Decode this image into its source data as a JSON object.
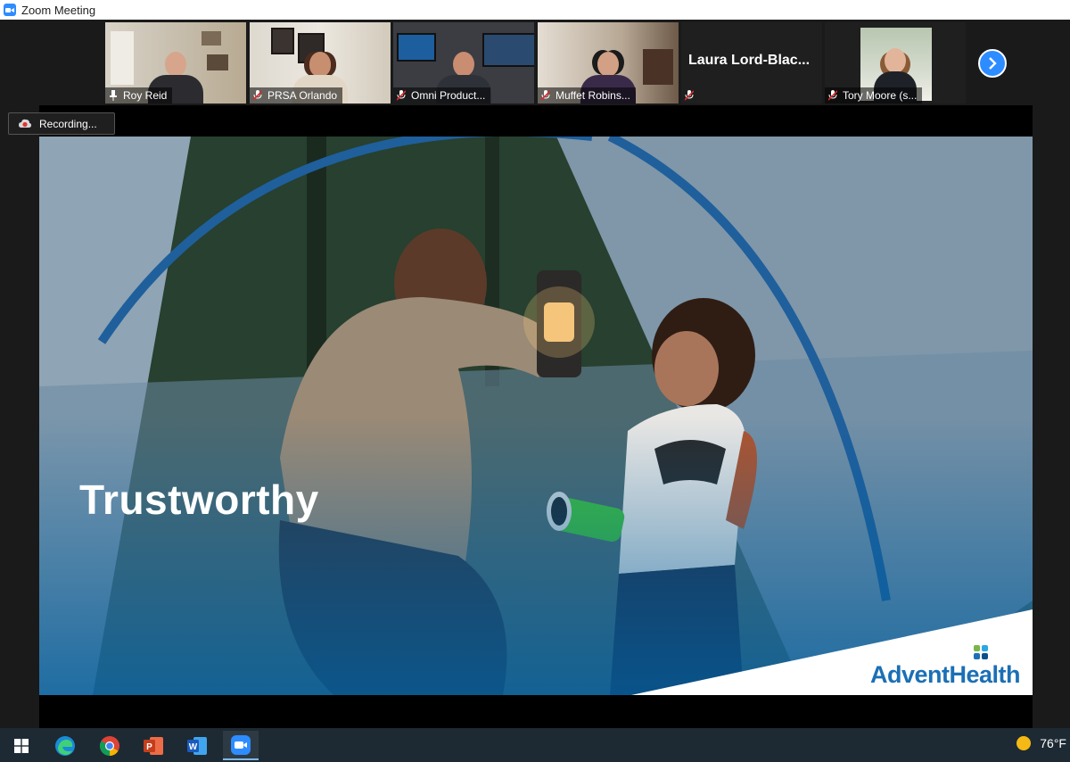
{
  "window": {
    "title": "Zoom Meeting"
  },
  "participants": [
    {
      "name": "Roy Reid",
      "video": true,
      "muted": false,
      "active_speaker": true
    },
    {
      "name": "PRSA Orlando",
      "video": true,
      "muted": true
    },
    {
      "name": "Omni Product...",
      "video": true,
      "muted": true
    },
    {
      "name": "Muffet Robins...",
      "video": true,
      "muted": true
    },
    {
      "name": "Laura  Lord-Blac...",
      "video": false,
      "muted": true
    },
    {
      "name": "Tory Moore (s...",
      "video": true,
      "muted": true
    }
  ],
  "recording": {
    "label": "Recording..."
  },
  "slide": {
    "heading": "Trustworthy",
    "brand": "AdventHealth"
  },
  "taskbar": {
    "apps": [
      "windows-start",
      "edge",
      "chrome",
      "powerpoint",
      "word",
      "zoom"
    ],
    "active_app": "zoom",
    "temperature": "76°F"
  },
  "colors": {
    "zoom_blue": "#2d8cff",
    "active_speaker_border": "#8bd13c",
    "brand_blue": "#1b6fb5"
  },
  "icons": {
    "muted_mic": "mic-off-icon",
    "next_page": "chevron-right-icon",
    "recording": "cloud-record-icon"
  }
}
